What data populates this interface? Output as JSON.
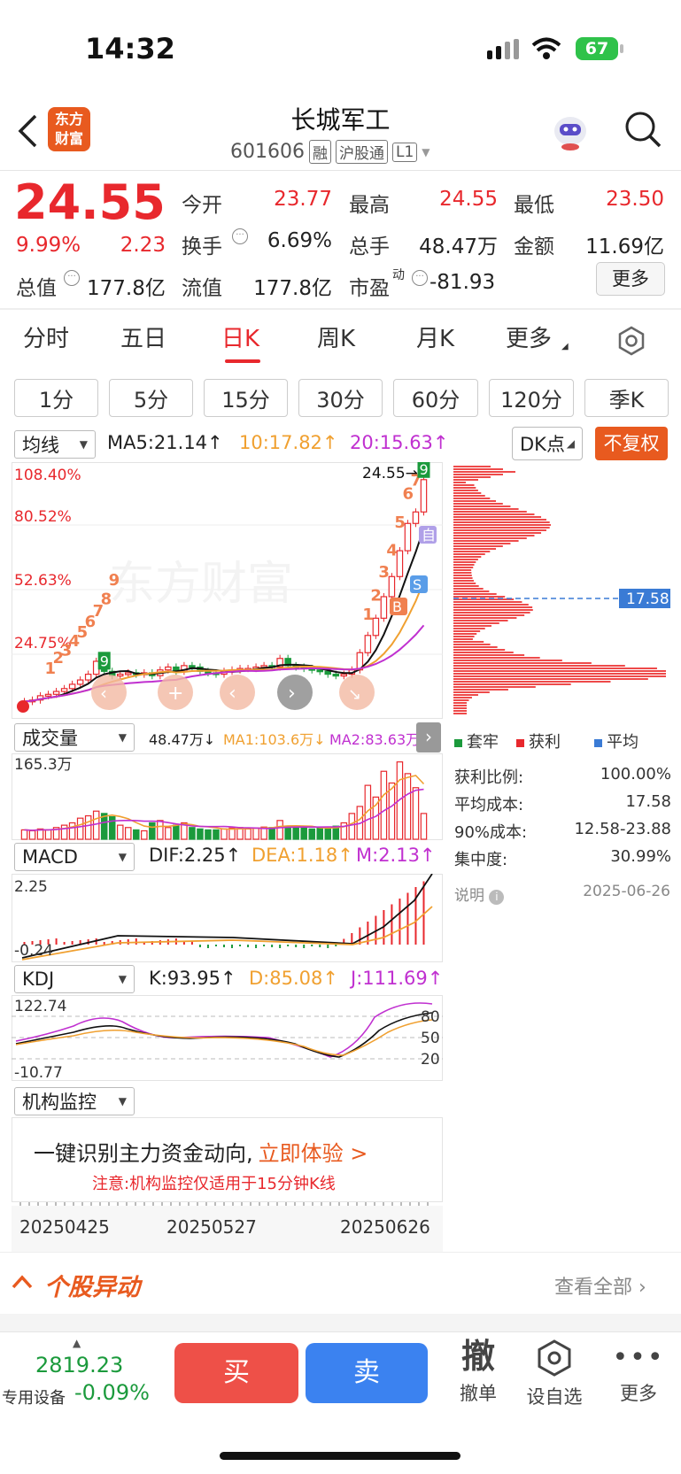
{
  "status": {
    "time": "14:32",
    "battery": "67"
  },
  "header": {
    "logo_line1": "东方",
    "logo_line2": "财富",
    "title": "长城军工",
    "code": "601606",
    "tag1": "融",
    "tag2": "沪股通",
    "tag3": "L1"
  },
  "quote": {
    "price": "24.55",
    "pct": "9.99%",
    "chg": "2.23",
    "open_l": "今开",
    "open": "23.77",
    "high_l": "最高",
    "high": "24.55",
    "low_l": "最低",
    "low": "23.50",
    "turn_l": "换手",
    "turn": "6.69%",
    "vol_l": "总手",
    "vol": "48.47万",
    "amt_l": "金额",
    "amt": "11.69亿",
    "mcap_l": "总值",
    "mcap": "177.8亿",
    "float_l": "流值",
    "float": "177.8亿",
    "pe_l": "市盈",
    "pe_sup": "动",
    "pe": "-81.93",
    "more": "更多"
  },
  "tabs": [
    "分时",
    "五日",
    "日K",
    "周K",
    "月K",
    "更多"
  ],
  "periods": [
    "1分",
    "5分",
    "15分",
    "30分",
    "60分",
    "120分",
    "季K"
  ],
  "ma": {
    "dropdown": "均线",
    "ma5": "MA5:21.14↑",
    "ma10": "10:17.82↑",
    "ma20": "20:15.63↑",
    "dk": "DK点",
    "fq": "不复权"
  },
  "kline": {
    "p1": "108.40%",
    "p2": "80.52%",
    "p3": "52.63%",
    "p4": "24.75%",
    "last": "24.55→",
    "pnt": "17.58",
    "marks": [
      "1",
      "2",
      "3",
      "4",
      "5",
      "6",
      "7",
      "8",
      "9"
    ],
    "bs": [
      "B",
      "S",
      "自"
    ],
    "left_marks": [
      "1",
      "2",
      "3",
      "4",
      "5",
      "6",
      "7",
      "8",
      "9"
    ]
  },
  "volume": {
    "dropdown": "成交量",
    "v": "48.47万↓",
    "ma1": "MA1:103.6万↓",
    "ma2": "MA2:83.63万",
    "max": "165.3万"
  },
  "macd": {
    "dropdown": "MACD",
    "dif": "DIF:2.25↑",
    "dea": "DEA:1.18↑",
    "m": "M:2.13↑",
    "top": "2.25",
    "bot": "-0.24"
  },
  "kdj": {
    "dropdown": "KDJ",
    "k": "K:93.95↑",
    "d": "D:85.08↑",
    "j": "J:111.69↑",
    "top": "122.74",
    "bot": "-10.77",
    "l80": "80",
    "l50": "50",
    "l20": "20"
  },
  "inst": {
    "dropdown": "机构监控",
    "promo": "一键识别主力资金动向,",
    "cta": "立即体验 >",
    "note": "注意:机构监控仅适用于15分钟K线"
  },
  "dates": [
    "20250425",
    "20250527",
    "20250626"
  ],
  "chips": {
    "legend": [
      "套牢",
      "获利",
      "平均"
    ],
    "rows": [
      {
        "l": "获利比例:",
        "v": "100.00%"
      },
      {
        "l": "平均成本:",
        "v": "17.58"
      },
      {
        "l": "90%成本:",
        "v": "12.58-23.88"
      },
      {
        "l": "集中度:",
        "v": "30.99%"
      }
    ],
    "note": "说明",
    "date": "2025-06-26"
  },
  "news": {
    "title": "个股异动",
    "all": "查看全部"
  },
  "bottom": {
    "index": "2819.23",
    "index_name": "专用设备",
    "index_chg": "-0.09%",
    "buy": "买",
    "sell": "卖",
    "cancel_icon": "撤",
    "cancel": "撤单",
    "fav": "设自选",
    "more": "更多"
  },
  "chart_data": {
    "type": "candlestick",
    "dates": [
      "20250425",
      "20250527",
      "20250626"
    ],
    "last_close": 24.55,
    "avg_cost": 17.58,
    "ma": {
      "MA5": 21.14,
      "MA10": 17.82,
      "MA20": 15.63
    },
    "volume": {
      "VOL": "48.47万",
      "MA1": "103.6万",
      "MA2": "83.63万",
      "max": "165.3万"
    },
    "macd": {
      "DIF": 2.25,
      "DEA": 1.18,
      "M": 2.13,
      "range": [
        -0.24,
        2.25
      ]
    },
    "kdj": {
      "K": 93.95,
      "D": 85.08,
      "J": 111.69,
      "range": [
        -10.77,
        122.74
      ],
      "levels": [
        80,
        50,
        20
      ]
    },
    "closes": [
      9.1,
      9.2,
      9.5,
      9.6,
      9.8,
      10.0,
      10.3,
      10.6,
      11.0,
      11.9,
      11.2,
      10.9,
      11.0,
      11.1,
      11.0,
      11.1,
      10.9,
      11.3,
      11.5,
      11.2,
      11.6,
      11.5,
      11.2,
      11.1,
      11.0,
      11.2,
      11.3,
      11.4,
      11.4,
      11.5,
      11.6,
      11.5,
      12.1,
      11.6,
      11.5,
      11.4,
      11.3,
      11.2,
      11.0,
      10.9,
      11.0,
      11.3,
      12.5,
      13.7,
      14.9,
      16.4,
      17.8,
      19.6,
      21.5,
      22.3,
      24.55
    ],
    "volumes": [
      20,
      18,
      22,
      20,
      25,
      30,
      35,
      45,
      50,
      60,
      55,
      48,
      30,
      25,
      20,
      18,
      35,
      40,
      25,
      30,
      35,
      25,
      22,
      20,
      20,
      22,
      24,
      25,
      22,
      24,
      26,
      25,
      40,
      28,
      25,
      24,
      22,
      25,
      24,
      28,
      35,
      55,
      70,
      115,
      90,
      145,
      120,
      165,
      140,
      110,
      55
    ]
  }
}
